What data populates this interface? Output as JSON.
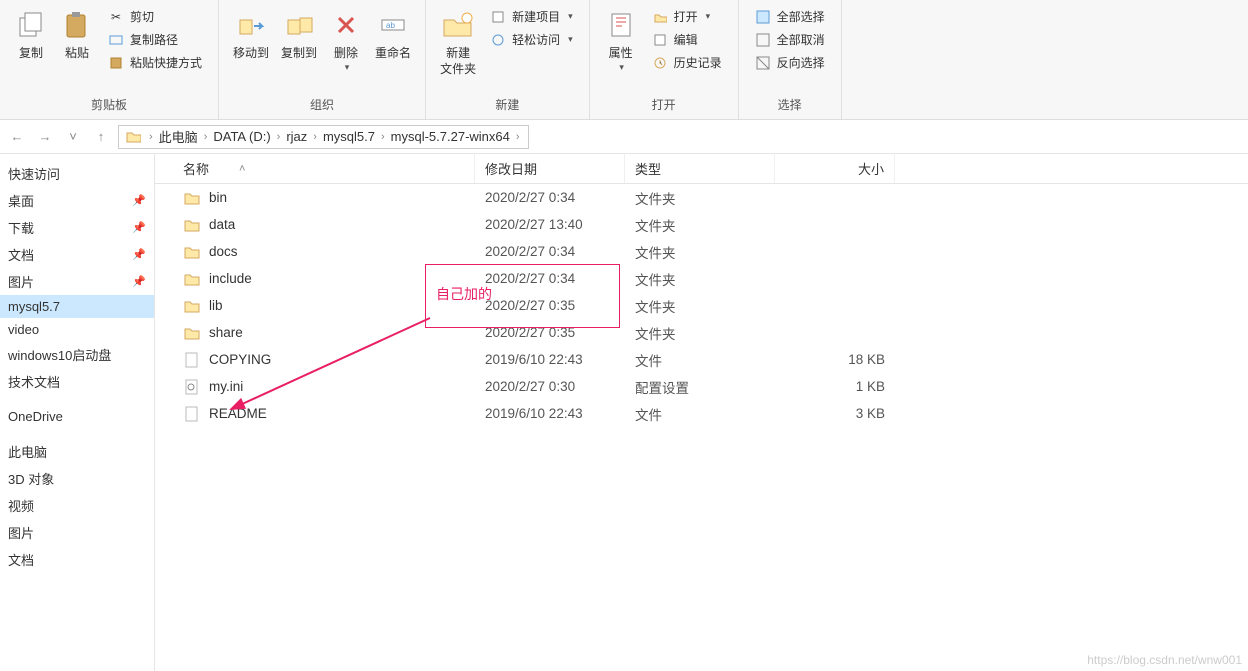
{
  "ribbon": {
    "clipboard": {
      "label": "剪贴板",
      "copy": "复制",
      "paste": "粘贴",
      "cut": "剪切",
      "copy_path": "复制路径",
      "paste_shortcut": "粘贴快捷方式"
    },
    "organize": {
      "label": "组织",
      "move_to": "移动到",
      "copy_to": "复制到",
      "delete": "删除",
      "rename": "重命名"
    },
    "new": {
      "label": "新建",
      "new_folder": "新建\n文件夹",
      "new_item": "新建项目",
      "easy_access": "轻松访问"
    },
    "open": {
      "label": "打开",
      "properties": "属性",
      "open": "打开",
      "edit": "编辑",
      "history": "历史记录"
    },
    "select": {
      "label": "选择",
      "select_all": "全部选择",
      "select_none": "全部取消",
      "invert": "反向选择"
    }
  },
  "breadcrumb": [
    "此电脑",
    "DATA (D:)",
    "rjaz",
    "mysql5.7",
    "mysql-5.7.27-winx64"
  ],
  "sidebar": {
    "quick": "快速访问",
    "pinned": [
      {
        "label": "桌面"
      },
      {
        "label": "下载"
      },
      {
        "label": "文档"
      },
      {
        "label": "图片"
      }
    ],
    "recent": [
      {
        "label": "mysql5.7"
      },
      {
        "label": "video"
      },
      {
        "label": "windows10启动盘"
      },
      {
        "label": "技术文档"
      }
    ],
    "onedrive": "OneDrive",
    "thispc": "此电脑",
    "pc_items": [
      "3D 对象",
      "视频",
      "图片",
      "文档"
    ]
  },
  "columns": {
    "name": "名称",
    "date": "修改日期",
    "type": "类型",
    "size": "大小"
  },
  "files": [
    {
      "icon": "folder",
      "name": "bin",
      "date": "2020/2/27 0:34",
      "type": "文件夹",
      "size": ""
    },
    {
      "icon": "folder",
      "name": "data",
      "date": "2020/2/27 13:40",
      "type": "文件夹",
      "size": ""
    },
    {
      "icon": "folder",
      "name": "docs",
      "date": "2020/2/27 0:34",
      "type": "文件夹",
      "size": ""
    },
    {
      "icon": "folder",
      "name": "include",
      "date": "2020/2/27 0:34",
      "type": "文件夹",
      "size": ""
    },
    {
      "icon": "folder",
      "name": "lib",
      "date": "2020/2/27 0:35",
      "type": "文件夹",
      "size": ""
    },
    {
      "icon": "folder",
      "name": "share",
      "date": "2020/2/27 0:35",
      "type": "文件夹",
      "size": ""
    },
    {
      "icon": "file",
      "name": "COPYING",
      "date": "2019/6/10 22:43",
      "type": "文件",
      "size": "18 KB"
    },
    {
      "icon": "ini",
      "name": "my.ini",
      "date": "2020/2/27 0:30",
      "type": "配置设置",
      "size": "1 KB"
    },
    {
      "icon": "file",
      "name": "README",
      "date": "2019/6/10 22:43",
      "type": "文件",
      "size": "3 KB"
    }
  ],
  "annotation": {
    "text": "自己加的"
  },
  "watermark": "https://blog.csdn.net/wnw001"
}
